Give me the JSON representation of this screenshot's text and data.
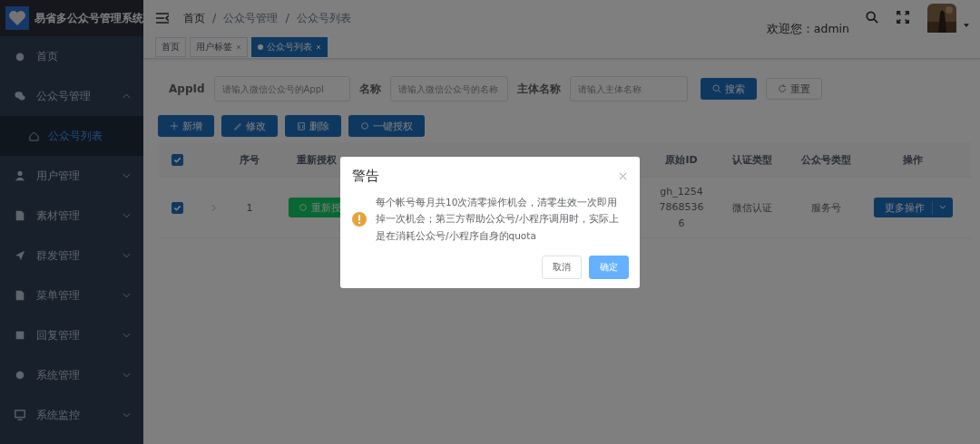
{
  "app": {
    "title": "易省多公众号管理系统"
  },
  "sidebar": {
    "items": [
      {
        "label": "首页"
      },
      {
        "label": "公众号管理",
        "expanded": true,
        "children": [
          {
            "label": "公众号列表",
            "selected": true
          }
        ]
      },
      {
        "label": "用户管理",
        "expanded": false
      },
      {
        "label": "素材管理",
        "expanded": false
      },
      {
        "label": "群发管理",
        "expanded": false
      },
      {
        "label": "菜单管理",
        "expanded": false
      },
      {
        "label": "回复管理",
        "expanded": false
      },
      {
        "label": "系统管理",
        "expanded": false
      },
      {
        "label": "系统监控",
        "expanded": false
      }
    ]
  },
  "breadcrumb": {
    "separator": "/",
    "items": [
      "首页",
      "公众号管理",
      "公众号列表"
    ]
  },
  "user": {
    "welcome": "欢迎您：admin"
  },
  "tabs": [
    {
      "label": "首页",
      "closable": false,
      "selected": false
    },
    {
      "label": "用户标签",
      "closable": true,
      "selected": false
    },
    {
      "label": "公众号列表",
      "closable": true,
      "selected": true
    }
  ],
  "search": {
    "fields": [
      {
        "label": "AppId",
        "placeholder": "请输入微信公众号的AppI"
      },
      {
        "label": "名称",
        "placeholder": "请输入微信公众号的名称"
      },
      {
        "label": "主体名称",
        "placeholder": "请输入主体名称"
      }
    ],
    "search_button": "搜索",
    "reset_button": "重置"
  },
  "toolbar": [
    "新增",
    "修改",
    "删除",
    "一键授权"
  ],
  "table": {
    "all_checked": true,
    "columns": [
      "序号",
      "重新授权",
      "原始ID",
      "认证类型",
      "公众号类型",
      "操作"
    ],
    "rows": [
      {
        "checked": true,
        "index": "1",
        "reauth": "重新授",
        "original_id": "gh_125478685366",
        "auth_type": "微信认证",
        "account_type": "服务号",
        "action": "更多操作"
      }
    ]
  },
  "dialog": {
    "title": "警告",
    "message": "每个帐号每月共10次清零操作机会，清零生效一次即用掉一次机会；第三方帮助公众号/小程序调用时，实际上是在消耗公众号/小程序自身的quota",
    "cancel": "取消",
    "confirm": "确定"
  }
}
